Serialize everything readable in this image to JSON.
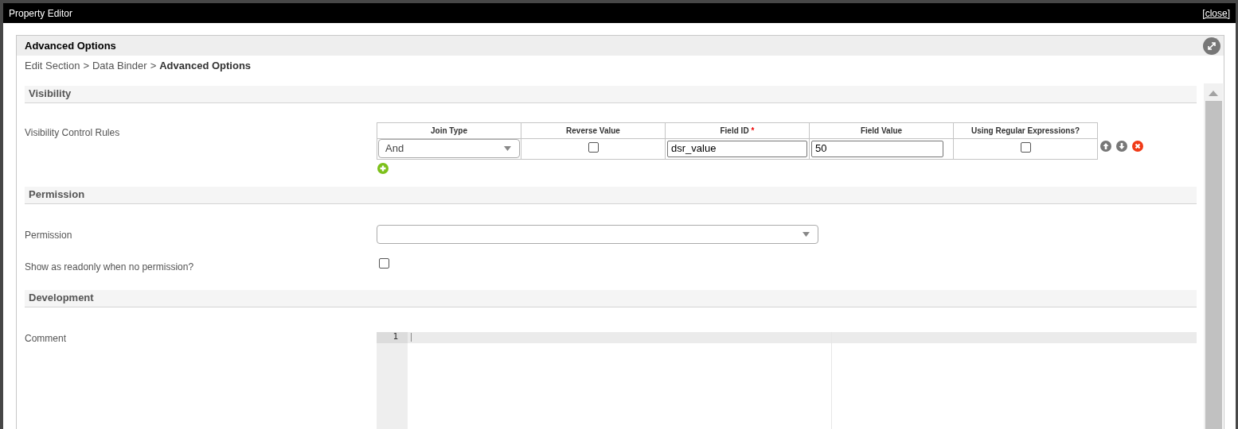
{
  "window": {
    "title": "Property Editor",
    "close_link": "[close]"
  },
  "panel": {
    "title": "Advanced Options",
    "breadcrumb": {
      "links": [
        "Edit Section",
        "Data Binder"
      ],
      "separator": ">",
      "current": "Advanced Options"
    },
    "sections": [
      {
        "kind": "visibility",
        "title": "Visibility",
        "label": "Visibility Control Rules",
        "columns": [
          {
            "label": "Join Type",
            "required": false
          },
          {
            "label": "Reverse Value",
            "required": false
          },
          {
            "label": "Field ID",
            "required": true
          },
          {
            "label": "Field Value",
            "required": false
          },
          {
            "label": "Using Regular Expressions?",
            "required": false
          }
        ],
        "required_mark": "*",
        "rows": [
          {
            "join_type": "And",
            "reverse_value": false,
            "field_id": "dsr_value",
            "field_value": "50",
            "using_regex": false
          }
        ]
      },
      {
        "kind": "permission",
        "title": "Permission",
        "label": "Permission",
        "readonly_label": "Show as readonly when no permission?",
        "readonly_checked": false
      },
      {
        "kind": "development",
        "title": "Development",
        "label": "Comment",
        "line_numbers": [
          "1"
        ]
      }
    ]
  }
}
